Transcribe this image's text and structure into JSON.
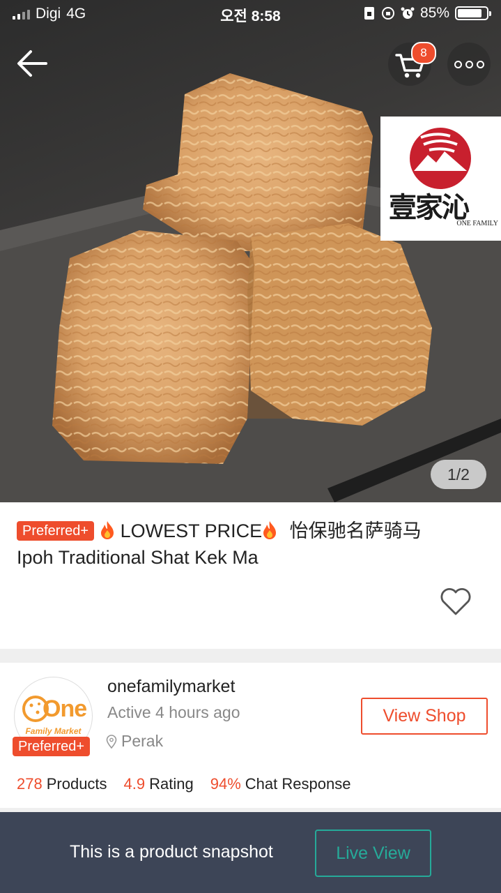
{
  "status_bar": {
    "carrier": "Digi",
    "network": "4G",
    "time": "오전 8:58",
    "battery_percent": "85%",
    "battery_level": 0.85
  },
  "nav": {
    "back_icon": "arrow-left-icon",
    "cart_icon": "cart-icon",
    "cart_count": "8",
    "more_icon": "more-icon"
  },
  "gallery": {
    "counter": "1/2"
  },
  "brand_logo": {
    "chinese_text": "壹家沁",
    "english_text": "ONE FAMILY"
  },
  "product": {
    "tag": "Preferred+",
    "title_part1": "LOWEST PRICE",
    "title_part2": "怡保驰名萨骑马",
    "title_line2": "Ipoh Traditional Shat Kek Ma",
    "fire_icon": "fire-icon",
    "favorite_icon": "heart-icon"
  },
  "shop": {
    "logo_text": "One",
    "logo_subtext": "Family Market",
    "tag": "Preferred+",
    "name": "onefamilymarket",
    "active": "Active 4 hours ago",
    "location": "Perak",
    "view_shop_label": "View Shop",
    "stats": [
      {
        "value": "278",
        "label": "Products"
      },
      {
        "value": "4.9",
        "label": "Rating"
      },
      {
        "value": "94%",
        "label": "Chat Response"
      }
    ]
  },
  "bottom_bar": {
    "snapshot_text": "This is a product snapshot",
    "live_view_label": "Live View"
  },
  "colors": {
    "accent": "#ee4d2d",
    "teal": "#26aa99",
    "bottom_bar": "#3d4557"
  }
}
